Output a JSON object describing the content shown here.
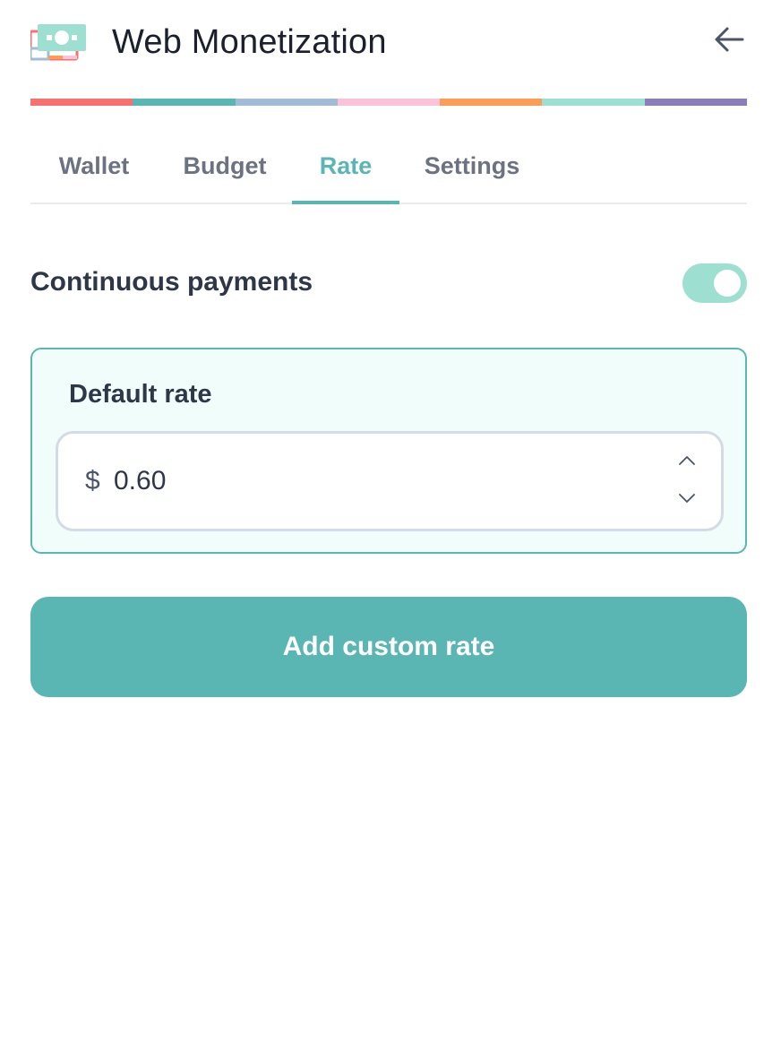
{
  "header": {
    "title": "Web Monetization",
    "logo_icon": "money-bill-icon",
    "back_icon": "arrow-left-icon"
  },
  "stripe_colors": [
    "#f87171",
    "#5ab6b2",
    "#a0bcd6",
    "#fbc3d8",
    "#fb9c57",
    "#9ddfd0",
    "#8b7db8"
  ],
  "tabs": [
    {
      "label": "Wallet",
      "active": false
    },
    {
      "label": "Budget",
      "active": false
    },
    {
      "label": "Rate",
      "active": true
    },
    {
      "label": "Settings",
      "active": false
    }
  ],
  "continuous_payments": {
    "label": "Continuous payments",
    "enabled": true
  },
  "default_rate": {
    "title": "Default rate",
    "currency_symbol": "$",
    "value": "0.60",
    "step_up_icon": "chevron-up-icon",
    "step_down_icon": "chevron-down-icon"
  },
  "add_custom_rate": {
    "label": "Add custom rate"
  },
  "colors": {
    "accent": "#5ab6b2",
    "toggle_on": "#9ddfd0",
    "card_bg": "#f0fdfb",
    "text_dark": "#2d3748",
    "text_muted": "#6b7280"
  }
}
